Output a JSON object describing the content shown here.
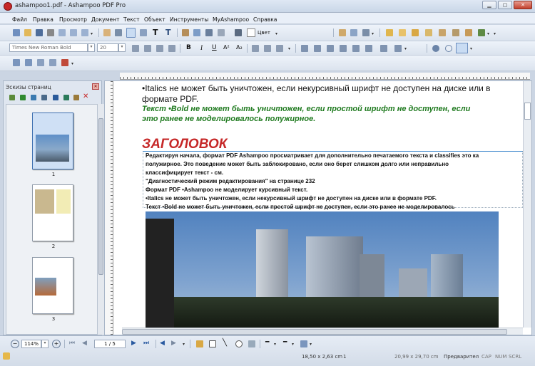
{
  "window": {
    "title": "ashampoo1.pdf - Ashampoo PDF Pro"
  },
  "menu": [
    "Файл",
    "Правка",
    "Просмотр",
    "Документ",
    "Текст",
    "Объект",
    "Инструменты",
    "MyAshampoo",
    "Справка"
  ],
  "toolbar": {
    "color_label": "Цвет"
  },
  "format_bar": {
    "font_name": "Times New Roman Bold",
    "font_size": "20"
  },
  "panel": {
    "title": "Эскизы страниц",
    "pages": [
      "1",
      "2",
      "3"
    ]
  },
  "document": {
    "line1": "•Italics не может быть уничтожен, если некурсивный шрифт не доступен на диске или в",
    "line2": "формате PDF.",
    "green1": "Текст •Bold не может быть уничтожен, если простой шрифт не доступен, если",
    "green2": "это ранее не моделировалось полужирное.",
    "heading": "ЗАГОЛОВОК",
    "body": [
      "Редактируя начала, формат PDF Ashampoo просматривает для дополнительно печатаемого текста и classifies это ка",
      "полужирное. Это поведение может быть заблокировано, если оно берет слишком долго или неправильно",
      "классифицирует текст - см.",
      "\"Диагностический режим редактирования\" на странице 232",
      "Формат PDF •Ashampoo не моделирует курсивный текст.",
      "•Italics не может быть уничтожен, если некурсивный шрифт не доступен на диске или в формате PDF.",
      "Текст •Bold не может быть уничтожен, если простой шрифт не доступен, если это ранее не моделировалось"
    ]
  },
  "status": {
    "zoom": "114%",
    "page": "1 / 5",
    "cursor_size": "18,50 x 2,63 cm",
    "cursor_count": "1",
    "page_size": "20,99 x 29,70 cm",
    "mode": "Предварител",
    "caps": "CAP",
    "num": "NUM",
    "scrl": "SCRL"
  },
  "colors": {
    "accent": "#2f6db5",
    "heading": "#c62828",
    "green_text": "#1f7a1f"
  }
}
